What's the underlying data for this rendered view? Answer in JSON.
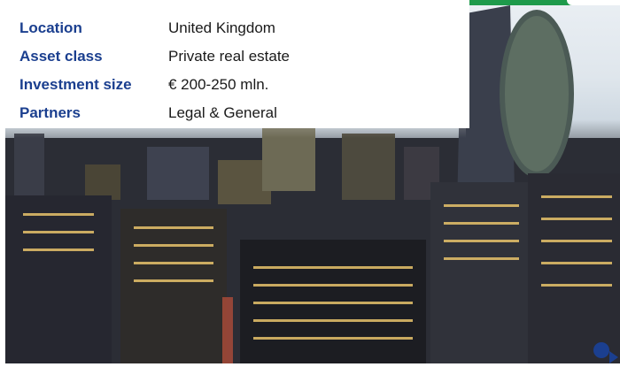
{
  "info_table": {
    "rows": [
      {
        "key": "Location",
        "value": "United Kingdom"
      },
      {
        "key": "Asset class",
        "value": "Private real estate"
      },
      {
        "key": "Investment size",
        "value": "€ 200-250 mln."
      },
      {
        "key": "Partners",
        "value": "Legal & General"
      }
    ]
  },
  "colors": {
    "label": "#1b3f8f",
    "band": "#1e9a4b"
  },
  "icons": {
    "corner": "arrow-dot-icon"
  }
}
